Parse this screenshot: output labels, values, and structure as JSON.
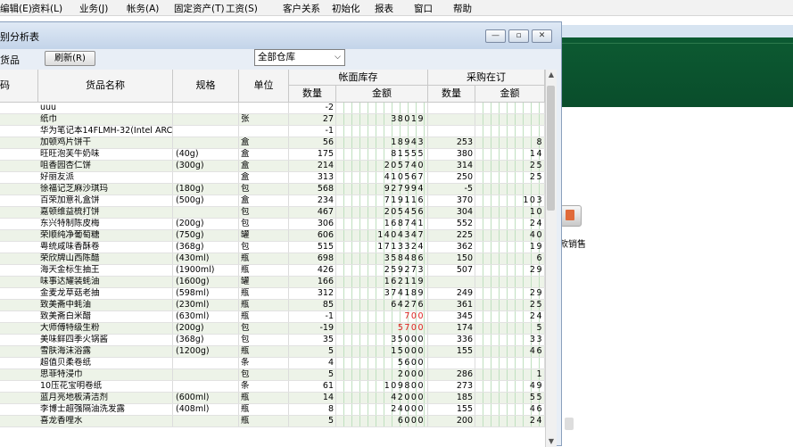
{
  "menu": [
    "编辑(E)",
    "资料(L)",
    "业务(J)",
    "帐务(A)",
    "固定资产(T)",
    "工资(S)",
    "客户关系",
    "初始化",
    "报表",
    "窗口",
    "帮助"
  ],
  "window": {
    "title": "别分析表",
    "minimize": "—",
    "restore": "▫",
    "close": "✕"
  },
  "toolbar": {
    "goods_label": "货品",
    "refresh_label": "刷新(R)",
    "warehouse": "全部仓库"
  },
  "desktop": {
    "label": "款销售"
  },
  "columns": {
    "code": "码",
    "name": "货品名称",
    "spec": "规格",
    "unit": "单位",
    "stock_group": "帐面库存",
    "purchase_group": "采购在订",
    "qty": "数量",
    "amount": "金额",
    "pqty": "数量",
    "pamount": "金额"
  },
  "rows": [
    {
      "name": "uuu",
      "spec": "",
      "unit": "",
      "qty": "-2",
      "amount": "",
      "pqty": "",
      "pamount": "",
      "red": false
    },
    {
      "name": "纸巾",
      "spec": "",
      "unit": "张",
      "qty": "27",
      "amount": "38019",
      "pqty": "",
      "pamount": "",
      "red": false
    },
    {
      "name": "华为笔记本14FLMH-32(Intel ARC I",
      "spec": "",
      "unit": "",
      "qty": "-1",
      "amount": "",
      "pqty": "",
      "pamount": "",
      "red": false
    },
    {
      "name": "加顿鸡片饼干",
      "spec": "",
      "unit": "盒",
      "qty": "56",
      "amount": "18943",
      "pqty": "253",
      "pamount": "8",
      "red": false
    },
    {
      "name": "旺旺泡芙牛奶味",
      "spec": "(40g)",
      "unit": "盒",
      "qty": "175",
      "amount": "81555",
      "pqty": "380",
      "pamount": "14",
      "red": false
    },
    {
      "name": "咀香园杏仁饼",
      "spec": "(300g)",
      "unit": "盒",
      "qty": "214",
      "amount": "205740",
      "pqty": "314",
      "pamount": "25",
      "red": false
    },
    {
      "name": "好丽友派",
      "spec": "",
      "unit": "盒",
      "qty": "313",
      "amount": "410567",
      "pqty": "250",
      "pamount": "25",
      "red": false
    },
    {
      "name": "徐福记芝麻沙琪玛",
      "spec": "(180g)",
      "unit": "包",
      "qty": "568",
      "amount": "927994",
      "pqty": "-5",
      "pamount": "",
      "red": false
    },
    {
      "name": "百荣加意礼盒饼",
      "spec": "(500g)",
      "unit": "盒",
      "qty": "234",
      "amount": "719116",
      "pqty": "370",
      "pamount": "103",
      "red": false
    },
    {
      "name": "嘉顿维益梳打饼",
      "spec": "",
      "unit": "包",
      "qty": "467",
      "amount": "205456",
      "pqty": "304",
      "pamount": "10",
      "red": false
    },
    {
      "name": "东兴特制陈皮梅",
      "spec": "(200g)",
      "unit": "包",
      "qty": "306",
      "amount": "168741",
      "pqty": "552",
      "pamount": "24",
      "red": false
    },
    {
      "name": "荣顺纯净葡萄糖",
      "spec": "(750g)",
      "unit": "罐",
      "qty": "606",
      "amount": "1404347",
      "pqty": "225",
      "pamount": "40",
      "red": false
    },
    {
      "name": "粤统咸味香酥卷",
      "spec": "(368g)",
      "unit": "包",
      "qty": "515",
      "amount": "1713324",
      "pqty": "362",
      "pamount": "19",
      "red": false
    },
    {
      "name": "荣欣牌山西陈醋",
      "spec": "(430ml)",
      "unit": "瓶",
      "qty": "698",
      "amount": "358486",
      "pqty": "150",
      "pamount": "6",
      "red": false
    },
    {
      "name": "海天金标生抽王",
      "spec": "(1900ml)",
      "unit": "瓶",
      "qty": "426",
      "amount": "259273",
      "pqty": "507",
      "pamount": "29",
      "red": false
    },
    {
      "name": "味事达耀装蚝油",
      "spec": "(1600g)",
      "unit": "罐",
      "qty": "166",
      "amount": "162119",
      "pqty": "",
      "pamount": "",
      "red": false
    },
    {
      "name": "金麦龙草菇老抽",
      "spec": "(598ml)",
      "unit": "瓶",
      "qty": "312",
      "amount": "374189",
      "pqty": "249",
      "pamount": "29",
      "red": false
    },
    {
      "name": "致美斋中蚝油",
      "spec": "(230ml)",
      "unit": "瓶",
      "qty": "85",
      "amount": "64276",
      "pqty": "361",
      "pamount": "25",
      "red": false
    },
    {
      "name": "致美斋白米醋",
      "spec": "(630ml)",
      "unit": "瓶",
      "qty": "-1",
      "amount": "700",
      "pqty": "345",
      "pamount": "24",
      "red": true
    },
    {
      "name": "大师傅特级生粉",
      "spec": "(200g)",
      "unit": "包",
      "qty": "-19",
      "amount": "5700",
      "pqty": "174",
      "pamount": "5",
      "red": true
    },
    {
      "name": "美味鲜四季火锅酱",
      "spec": "(368g)",
      "unit": "包",
      "qty": "35",
      "amount": "35000",
      "pqty": "336",
      "amount2": "",
      "pamount": "33",
      "red": false
    },
    {
      "name": "雪肤海沫浴露",
      "spec": "(1200g)",
      "unit": "瓶",
      "qty": "5",
      "amount": "15000",
      "pqty": "155",
      "pamount": "46",
      "red": false
    },
    {
      "name": "超值贝柔卷纸",
      "spec": "",
      "unit": "条",
      "qty": "4",
      "amount": "5600",
      "pqty": "",
      "pamount": "",
      "red": false
    },
    {
      "name": "思菲特浸巾",
      "spec": "",
      "unit": "包",
      "qty": "5",
      "amount": "2000",
      "pqty": "286",
      "pamount": "1",
      "red": false
    },
    {
      "name": "10压花宝明卷纸",
      "spec": "",
      "unit": "条",
      "qty": "61",
      "amount": "109800",
      "pqty": "273",
      "pamount": "49",
      "red": false
    },
    {
      "name": "蓝月亮地板清洁剂",
      "spec": "(600ml)",
      "unit": "瓶",
      "qty": "14",
      "amount": "42000",
      "pqty": "185",
      "pamount": "55",
      "red": false
    },
    {
      "name": "李博士超强隔油洗发露",
      "spec": "(408ml)",
      "unit": "瓶",
      "qty": "8",
      "amount": "24000",
      "pqty": "155",
      "pamount": "46",
      "red": false
    },
    {
      "name": "喜龙香哩水",
      "spec": "",
      "unit": "瓶",
      "qty": "5",
      "amount": "6000",
      "pqty": "200",
      "pamount": "24",
      "red": false
    }
  ]
}
